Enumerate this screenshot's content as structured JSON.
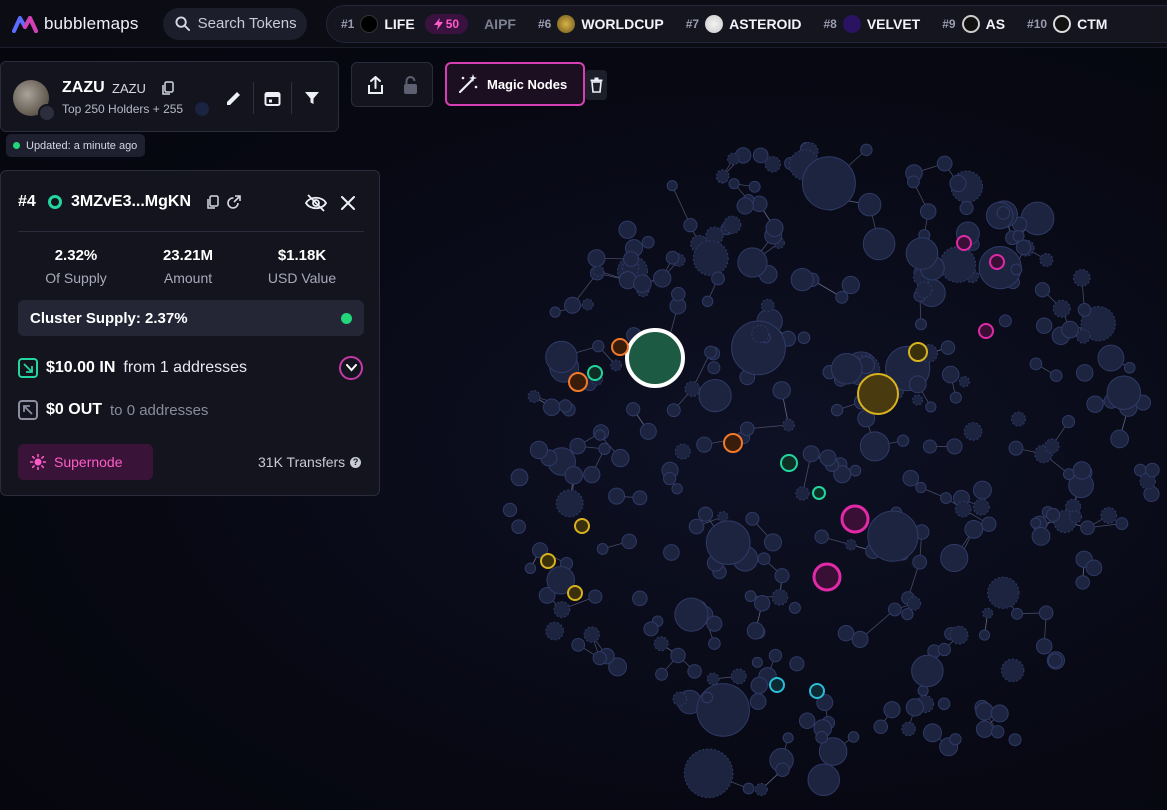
{
  "brand": {
    "name": "bubblemaps"
  },
  "search": {
    "label": "Search Tokens"
  },
  "trending": {
    "items": [
      {
        "rank": "#1",
        "name": "LIFE",
        "icon": "life-icon",
        "boost": "50"
      },
      {
        "rank": "",
        "name": "AIPF",
        "icon": "",
        "boost": ""
      },
      {
        "rank": "#6",
        "name": "WORLDCUP",
        "icon": "worldcup-icon",
        "boost": ""
      },
      {
        "rank": "#7",
        "name": "ASTEROID",
        "icon": "asteroid-icon",
        "boost": ""
      },
      {
        "rank": "#8",
        "name": "VELVET",
        "icon": "velvet-icon",
        "boost": ""
      },
      {
        "rank": "#9",
        "name": "AS",
        "icon": "as-icon",
        "boost": ""
      },
      {
        "rank": "#10",
        "name": "CTM",
        "icon": "ctm-icon",
        "boost": ""
      }
    ]
  },
  "token": {
    "name": "ZAZU",
    "symbol": "ZAZU",
    "subtitle": "Top 250 Holders + 255",
    "updated": "Updated: a minute ago"
  },
  "toolbar": {
    "magic_label": "Magic Nodes"
  },
  "wallet": {
    "rank": "#4",
    "address": "3MZvE3...MgKN",
    "stats": [
      {
        "value": "2.32%",
        "label": "Of Supply"
      },
      {
        "value": "23.21M",
        "label": "Amount"
      },
      {
        "value": "$1.18K",
        "label": "USD Value"
      }
    ],
    "cluster_supply": "Cluster Supply: 2.37%",
    "in_amount": "$10.00 IN",
    "in_from": "from 1 addresses",
    "out_amount": "$0 OUT",
    "out_to": "to 0 addresses",
    "supernode_label": "Supernode",
    "transfers": "31K Transfers"
  },
  "colors": {
    "accent_pink": "#d63fb3",
    "green": "#22d67a",
    "bubble": "#1d2440",
    "bubble_stroke": "#2f3a66",
    "orange": "#f07a2a",
    "yellow": "#d9b21f",
    "teal": "#22d6a0",
    "cyan": "#2bbcd6",
    "magenta": "#e02aa8"
  }
}
